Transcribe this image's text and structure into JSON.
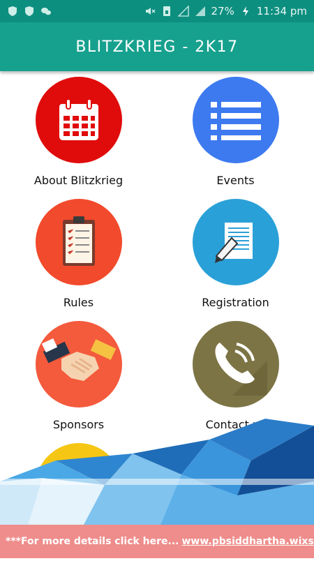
{
  "status_bar": {
    "battery": "27%",
    "time": "11:34 pm"
  },
  "app_bar": {
    "title": "BLITZKRIEG - 2K17"
  },
  "tiles": [
    {
      "label": "About Blitzkrieg",
      "icon": "calendar-icon",
      "color": "#e00b0b"
    },
    {
      "label": "Events",
      "icon": "list-icon",
      "color": "#3d7af0"
    },
    {
      "label": "Rules",
      "icon": "clipboard-icon",
      "color": "#f24a2c"
    },
    {
      "label": "Registration",
      "icon": "form-edit-icon",
      "color": "#2aa0d8"
    },
    {
      "label": "Sponsors",
      "icon": "handshake-icon",
      "color": "#f45a3c"
    },
    {
      "label": "Contact us",
      "icon": "phone-icon",
      "color": "#7d7446"
    },
    {
      "label": "",
      "icon": "map-pin-icon",
      "color": "#f5c613"
    },
    {
      "label": "",
      "icon": "picture-icon",
      "color": "#f24a2c"
    }
  ],
  "banner": {
    "prefix": "***For more details click here...",
    "link": "www.pbsiddhartha.wixsite.com/bli"
  },
  "colors": {
    "status_bar": "#0d8f80",
    "app_bar": "#16a18e",
    "banner": "#ee8d8b"
  }
}
